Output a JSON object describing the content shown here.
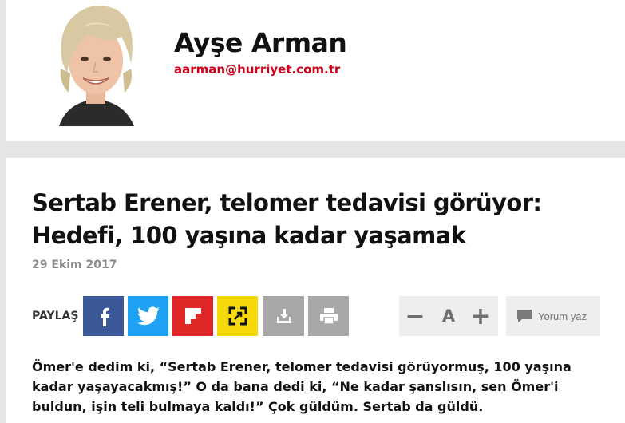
{
  "author": {
    "name": "Ayşe Arman",
    "email": "aarman@hurriyet.com.tr"
  },
  "article": {
    "headline_line1": "Sertab Erener, telomer tedavisi görüyor:",
    "headline_line2": "Hedefi, 100 yaşına kadar yaşamak",
    "date": "29 Ekim 2017",
    "body": "Ömer'e dedim ki, “Sertab Erener, telomer tedavisi görüyormuş, 100 yaşına kadar yaşayacakmış!” O da bana dedi ki, “Ne kadar şanslısın, sen Ömer'i buldun, işin teli bulmaya kaldı!” Çok güldüm. Sertab da güldü."
  },
  "share": {
    "label": "PAYLAŞ",
    "buttons": [
      {
        "name": "facebook",
        "icon": "facebook-icon",
        "color": "#3b5998"
      },
      {
        "name": "twitter",
        "icon": "twitter-icon",
        "color": "#1da1f2"
      },
      {
        "name": "flipboard",
        "icon": "flipboard-icon",
        "color": "#e12828"
      },
      {
        "name": "expand",
        "icon": "expand-icon",
        "color": "#f5d90a"
      },
      {
        "name": "save",
        "icon": "download-icon",
        "color": "#a8a8a8"
      },
      {
        "name": "print",
        "icon": "print-icon",
        "color": "#a8a8a8"
      }
    ]
  },
  "tools": {
    "font_decrease": "−",
    "font_label": "A",
    "font_increase": "+",
    "comment_label": "Yorum yaz"
  },
  "colors": {
    "accent_red": "#d0021b",
    "background": "#e5e5e5"
  }
}
